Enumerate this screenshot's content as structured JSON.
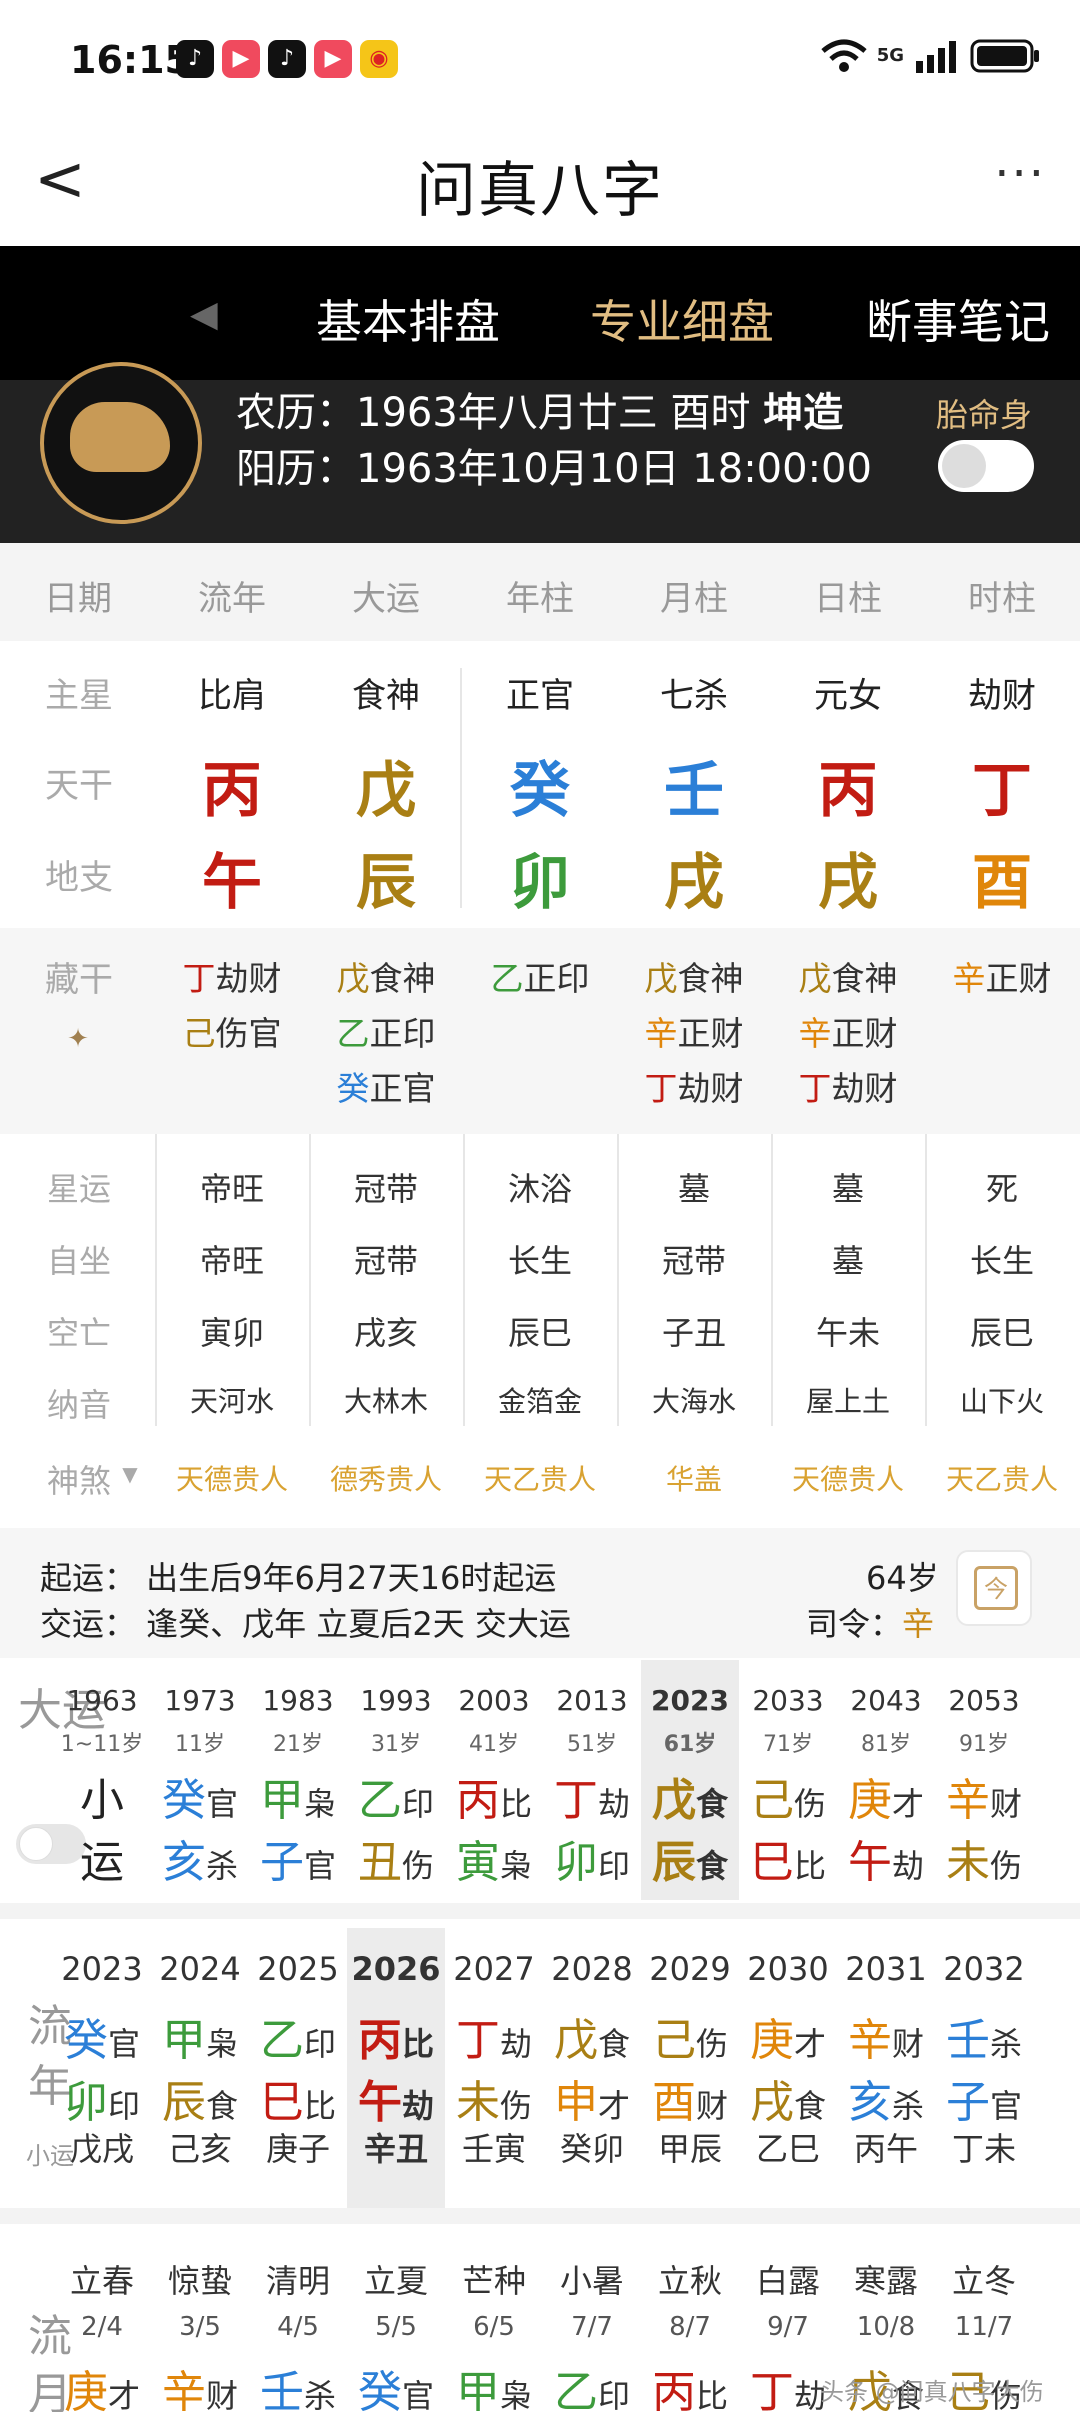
{
  "status": {
    "time": "16:15",
    "network": "5G"
  },
  "nav": {
    "title": "问真八字",
    "back": "<",
    "more": "···"
  },
  "tabs": [
    "基本排盘",
    "专业细盘",
    "断事笔记"
  ],
  "active_tab": "专业细盘",
  "header": {
    "lunar": "农历：1963年八月廿三 酉时",
    "gender": "坤造",
    "solar": "阳历：1963年10月10日 18:00:00",
    "taiming_label": "胎命身"
  },
  "columns": [
    "日期",
    "流年",
    "大运",
    "年柱",
    "月柱",
    "日柱",
    "时柱"
  ],
  "pillars": {
    "zhuxing_label": "主星",
    "zhuxing": [
      "比肩",
      "食神",
      "正官",
      "七杀",
      "元女",
      "劫财"
    ],
    "tiangan_label": "天干",
    "tiangan": [
      "丙",
      "戊",
      "癸",
      "壬",
      "丙",
      "丁"
    ],
    "dizhi_label": "地支",
    "dizhi": [
      "午",
      "辰",
      "卯",
      "戌",
      "戌",
      "酉"
    ]
  },
  "canggan": {
    "label": "藏干",
    "cols": [
      [
        [
          "丁",
          "劫财"
        ],
        [
          "己",
          "伤官"
        ]
      ],
      [
        [
          "戊",
          "食神"
        ],
        [
          "乙",
          "正印"
        ],
        [
          "癸",
          "正官"
        ]
      ],
      [
        [
          "乙",
          "正印"
        ]
      ],
      [
        [
          "戊",
          "食神"
        ],
        [
          "辛",
          "正财"
        ],
        [
          "丁",
          "劫财"
        ]
      ],
      [
        [
          "戊",
          "食神"
        ],
        [
          "辛",
          "正财"
        ],
        [
          "丁",
          "劫财"
        ]
      ],
      [
        [
          "辛",
          "正财"
        ]
      ]
    ]
  },
  "details": [
    {
      "label": "星运",
      "values": [
        "帝旺",
        "冠带",
        "沐浴",
        "墓",
        "墓",
        "死"
      ]
    },
    {
      "label": "自坐",
      "values": [
        "帝旺",
        "冠带",
        "长生",
        "冠带",
        "墓",
        "长生"
      ]
    },
    {
      "label": "空亡",
      "values": [
        "寅卯",
        "戌亥",
        "辰巳",
        "子丑",
        "午未",
        "辰巳"
      ]
    },
    {
      "label": "纳音",
      "values": [
        "天河水",
        "大林木",
        "金箔金",
        "大海水",
        "屋上土",
        "山下火"
      ]
    }
  ],
  "shensha": {
    "label": "神煞",
    "values": [
      "天德贵人",
      "德秀贵人",
      "天乙贵人",
      "华盖",
      "天德贵人",
      "天乙贵人"
    ]
  },
  "yun": {
    "qiyun": "起运：  出生后9年6月27天16时起运",
    "jiaoyun": "交运：  逢癸、戊年 立夏后2天 交大运",
    "age": "64岁",
    "siling_label": "司令：",
    "siling_value": "辛",
    "cal_icon": "今"
  },
  "dayun": {
    "label": "大运",
    "items": [
      {
        "year": "1963",
        "age": "1~11岁",
        "g": "小",
        "gs": "",
        "z": "运",
        "zs": ""
      },
      {
        "year": "1973",
        "age": "11岁",
        "g": "癸",
        "gs": "官",
        "z": "亥",
        "zs": "杀"
      },
      {
        "year": "1983",
        "age": "21岁",
        "g": "甲",
        "gs": "枭",
        "z": "子",
        "zs": "官"
      },
      {
        "year": "1993",
        "age": "31岁",
        "g": "乙",
        "gs": "印",
        "z": "丑",
        "zs": "伤"
      },
      {
        "year": "2003",
        "age": "41岁",
        "g": "丙",
        "gs": "比",
        "z": "寅",
        "zs": "枭"
      },
      {
        "year": "2013",
        "age": "51岁",
        "g": "丁",
        "gs": "劫",
        "z": "卯",
        "zs": "印"
      },
      {
        "year": "2023",
        "age": "61岁",
        "g": "戊",
        "gs": "食",
        "z": "辰",
        "zs": "食"
      },
      {
        "year": "2033",
        "age": "71岁",
        "g": "己",
        "gs": "伤",
        "z": "巳",
        "zs": "比"
      },
      {
        "year": "2043",
        "age": "81岁",
        "g": "庚",
        "gs": "才",
        "z": "午",
        "zs": "劫"
      },
      {
        "year": "2053",
        "age": "91岁",
        "g": "辛",
        "gs": "财",
        "z": "未",
        "zs": "伤"
      }
    ]
  },
  "liunian": {
    "label1": "流",
    "label2": "年",
    "sub": "小运",
    "items": [
      {
        "year": "2023",
        "g": "癸",
        "gs": "官",
        "z": "卯",
        "zs": "印",
        "x": "戊戌"
      },
      {
        "year": "2024",
        "g": "甲",
        "gs": "枭",
        "z": "辰",
        "zs": "食",
        "x": "己亥"
      },
      {
        "year": "2025",
        "g": "乙",
        "gs": "印",
        "z": "巳",
        "zs": "比",
        "x": "庚子"
      },
      {
        "year": "2026",
        "g": "丙",
        "gs": "比",
        "z": "午",
        "zs": "劫",
        "x": "辛丑"
      },
      {
        "year": "2027",
        "g": "丁",
        "gs": "劫",
        "z": "未",
        "zs": "伤",
        "x": "壬寅"
      },
      {
        "year": "2028",
        "g": "戊",
        "gs": "食",
        "z": "申",
        "zs": "才",
        "x": "癸卯"
      },
      {
        "year": "2029",
        "g": "己",
        "gs": "伤",
        "z": "酉",
        "zs": "财",
        "x": "甲辰"
      },
      {
        "year": "2030",
        "g": "庚",
        "gs": "才",
        "z": "戌",
        "zs": "食",
        "x": "乙巳"
      },
      {
        "year": "2031",
        "g": "辛",
        "gs": "财",
        "z": "亥",
        "zs": "杀",
        "x": "丙午"
      },
      {
        "year": "2032",
        "g": "壬",
        "gs": "杀",
        "z": "子",
        "zs": "官",
        "x": "丁未"
      }
    ]
  },
  "liuyue": {
    "label1": "流",
    "label2": "月",
    "items": [
      {
        "term": "立春",
        "date": "2/4",
        "g": "庚",
        "gs": "才"
      },
      {
        "term": "惊蛰",
        "date": "3/5",
        "g": "辛",
        "gs": "财"
      },
      {
        "term": "清明",
        "date": "4/5",
        "g": "壬",
        "gs": "杀"
      },
      {
        "term": "立夏",
        "date": "5/5",
        "g": "癸",
        "gs": "官"
      },
      {
        "term": "芒种",
        "date": "6/5",
        "g": "甲",
        "gs": "枭"
      },
      {
        "term": "小暑",
        "date": "7/7",
        "g": "乙",
        "gs": "印"
      },
      {
        "term": "立秋",
        "date": "8/7",
        "g": "丙",
        "gs": "比"
      },
      {
        "term": "白露",
        "date": "9/7",
        "g": "丁",
        "gs": "劫"
      },
      {
        "term": "寒露",
        "date": "10/8",
        "g": "戊",
        "gs": "食"
      },
      {
        "term": "立冬",
        "date": "11/7",
        "g": "己",
        "gs": "伤"
      }
    ]
  },
  "watermark": "头条 @问真八字大伤",
  "colors": {
    "木": "#3d9b3c",
    "火": "#c21c13",
    "土": "#a97f14",
    "金": "#e0860a",
    "水": "#2b7fd7",
    "tab_active": "#e1bd82",
    "header_bg": "#222222"
  }
}
